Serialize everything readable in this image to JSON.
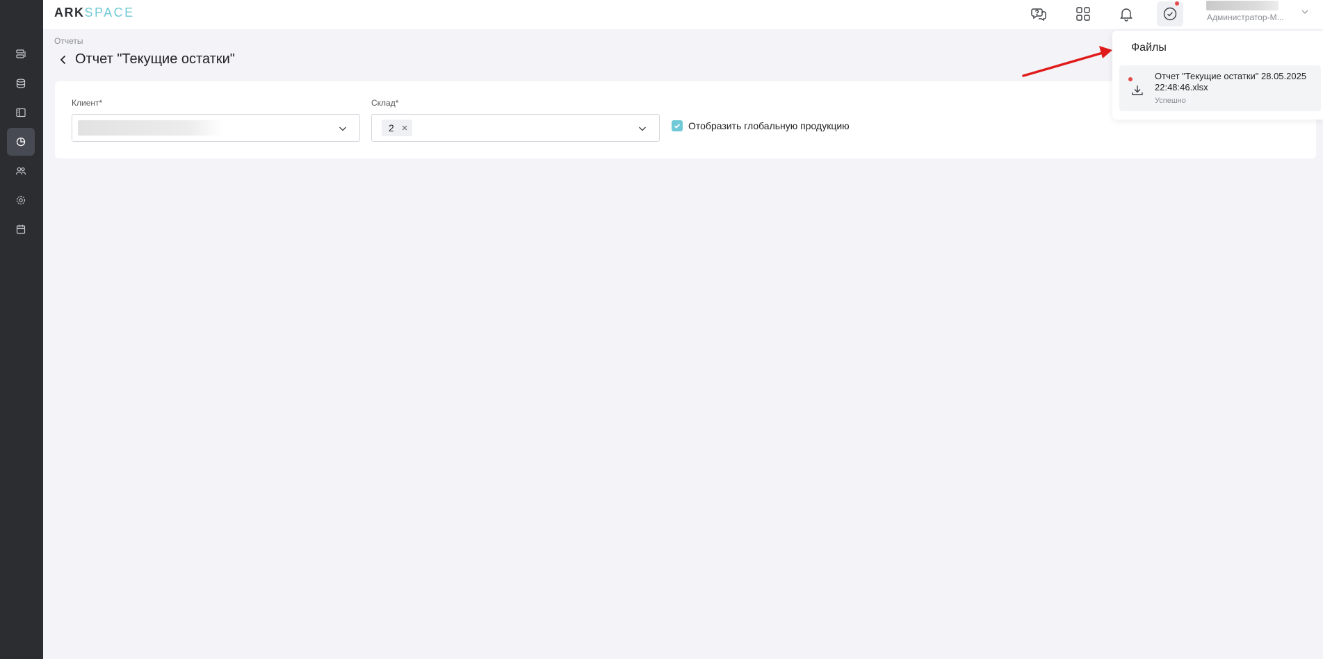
{
  "header": {
    "logo_ark": "ARK",
    "logo_space": "SPACE",
    "user_role": "Администратор-М..."
  },
  "sidebar": {
    "items": [
      {
        "icon": "list-icon"
      },
      {
        "icon": "database-icon"
      },
      {
        "icon": "layout-icon"
      },
      {
        "icon": "reports-pie-icon",
        "active": true
      },
      {
        "icon": "users-icon"
      },
      {
        "icon": "settings-gear-icon"
      },
      {
        "icon": "calendar-icon"
      }
    ]
  },
  "page": {
    "breadcrumb": "Отчеты",
    "title": "Отчет \"Текущие остатки\""
  },
  "filters": {
    "client_label": "Клиент*",
    "warehouse_label": "Склад*",
    "warehouse_chip": "2",
    "show_global_label": "Отобразить глобальную продукцию",
    "show_global_checked": true
  },
  "files_panel": {
    "title": "Файлы",
    "file_name": "Отчет \"Текущие остатки\" 28.05.2025 22:48:46.xlsx",
    "file_status": "Успешно"
  },
  "colors": {
    "sidebar_bg": "#2b2d31",
    "accent": "#6fc9d6",
    "alert": "#e34b4b",
    "arrow": "#e01b1b"
  }
}
